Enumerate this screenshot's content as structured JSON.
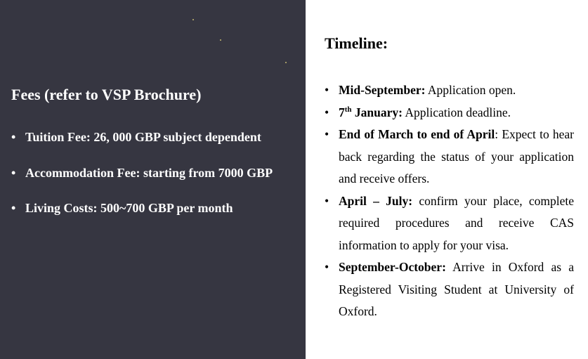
{
  "left": {
    "title": "Fees (refer to VSP Brochure)",
    "bullet": "•",
    "items": [
      {
        "text": "Tuition Fee: 26, 000 GBP subject dependent"
      },
      {
        "text": "Accommodation Fee: starting from 7000 GBP"
      },
      {
        "text": "Living Costs: 500~700 GBP per month"
      }
    ]
  },
  "right": {
    "title": "Timeline:",
    "bullet": "•",
    "items": [
      {
        "pre": "Mid-September:",
        "sup": "",
        "post": "",
        "text": " Application open."
      },
      {
        "pre": "7",
        "sup": "th",
        "post": " January:",
        "text": " Application deadline."
      },
      {
        "pre": "End of March to end of April",
        "sup": "",
        "post": "",
        "text": ": Expect to hear back regarding the status of your application and receive offers."
      },
      {
        "pre": "April – July:",
        "sup": "",
        "post": "",
        "text": " confirm your place, complete required procedures and receive CAS information to apply for your visa."
      },
      {
        "pre": "September-October:",
        "sup": "",
        "post": "",
        "text": " Arrive in Oxford as a Registered Visiting Student at University of Oxford."
      }
    ]
  },
  "colors": {
    "left_background": "#363641",
    "left_text": "#ffffff",
    "right_background": "#ffffff",
    "right_text": "#000000",
    "star": "#e0d27a"
  }
}
